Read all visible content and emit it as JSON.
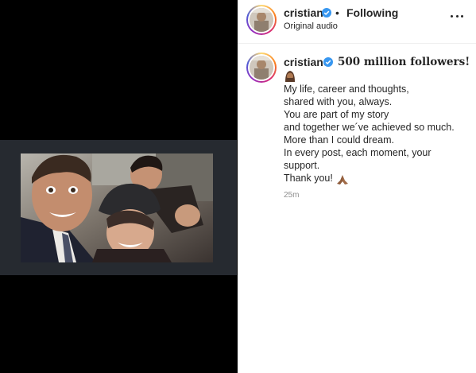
{
  "header": {
    "username": "cristiano",
    "separator": "•",
    "follow_status": "Following",
    "audio_label": "Original audio",
    "more_icon": "ellipsis-icon"
  },
  "caption": {
    "username": "cristiano",
    "headline": "500 million followers!",
    "lines": [
      "My life, career and thoughts,",
      "shared with you, always.",
      "You are part of my story",
      "and together we´ve achieved so much.",
      "More than I could dream.",
      "In every post, each moment, your",
      "support.",
      "Thank you!"
    ],
    "emoji_top": "person-with-headscarf-emoji",
    "emoji_end": "folded-hands-emoji",
    "time": "25m"
  },
  "colors": {
    "verified_blue": "#3897f0",
    "text": "#262626",
    "muted": "#8e8e8e",
    "divider": "#efefef"
  }
}
